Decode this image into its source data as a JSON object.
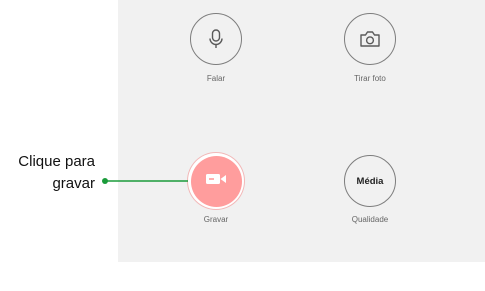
{
  "buttons": {
    "speak": {
      "label": "Falar",
      "icon": "microphone-icon"
    },
    "photo": {
      "label": "Tirar foto",
      "icon": "camera-icon"
    },
    "record": {
      "label": "Gravar",
      "icon": "video-camera-icon"
    },
    "quality": {
      "value": "Média",
      "label": "Qualidade"
    }
  },
  "callout": {
    "line1": "Clique para",
    "line2": "gravar"
  },
  "colors": {
    "panel_background": "#f1f1f1",
    "record_fill": "#ff9d9d",
    "connector": "#1a9b3a"
  }
}
